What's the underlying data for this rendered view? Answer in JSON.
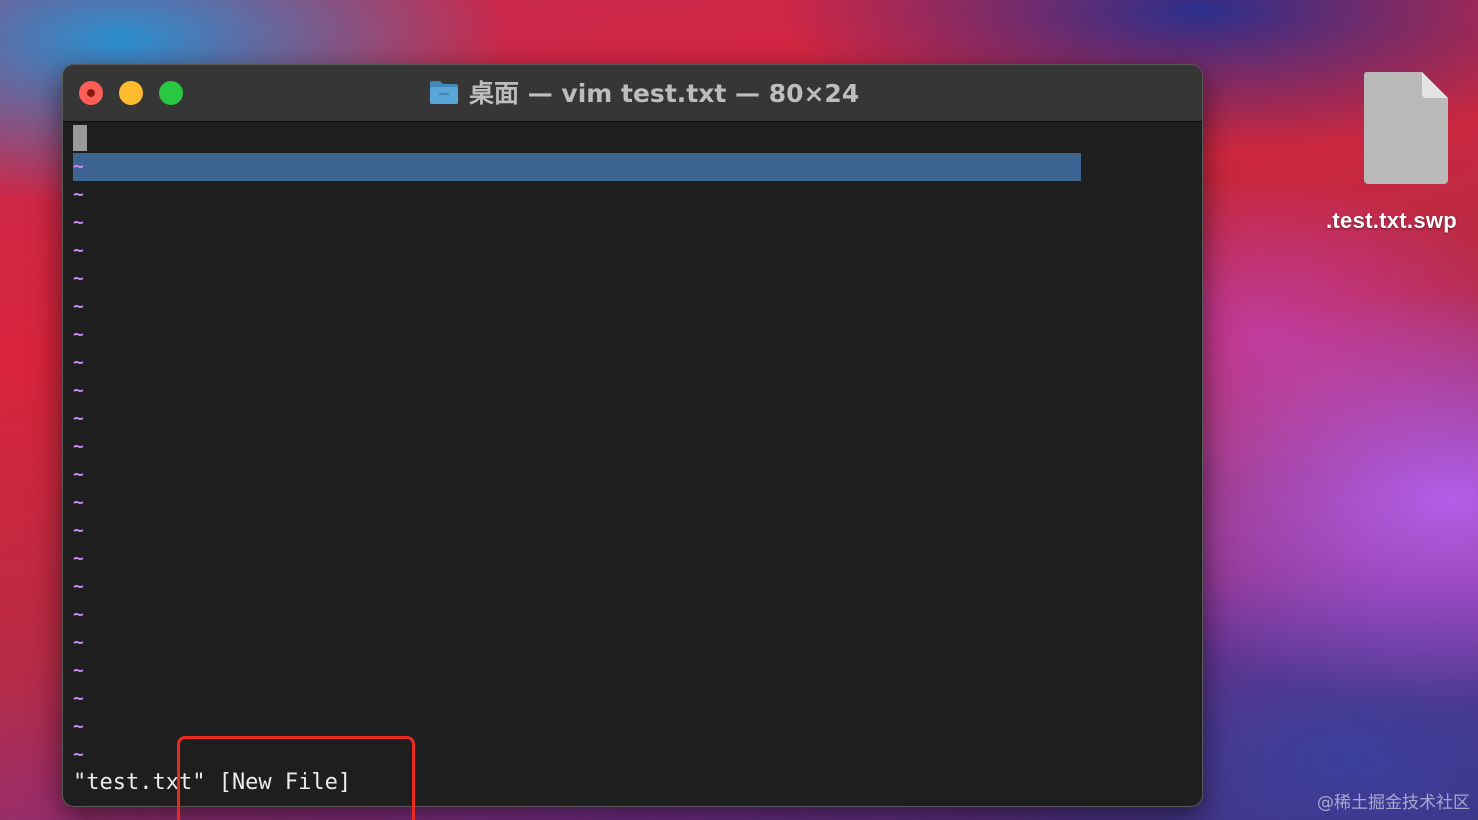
{
  "window": {
    "title": "桌面 — vim test.txt — 80×24"
  },
  "editor": {
    "tilde_char": "~",
    "status_line": "\"test.txt\" [New File]"
  },
  "desktop": {
    "file_label": ".test.txt.swp"
  },
  "watermark": "@稀土掘金技术社区",
  "colors": {
    "terminal_bg": "#1e1e1e",
    "titlebar_bg": "#363636",
    "highlight": "#3e6592",
    "tilde": "#c98bf3",
    "annotation_box": "#ea2a20"
  }
}
